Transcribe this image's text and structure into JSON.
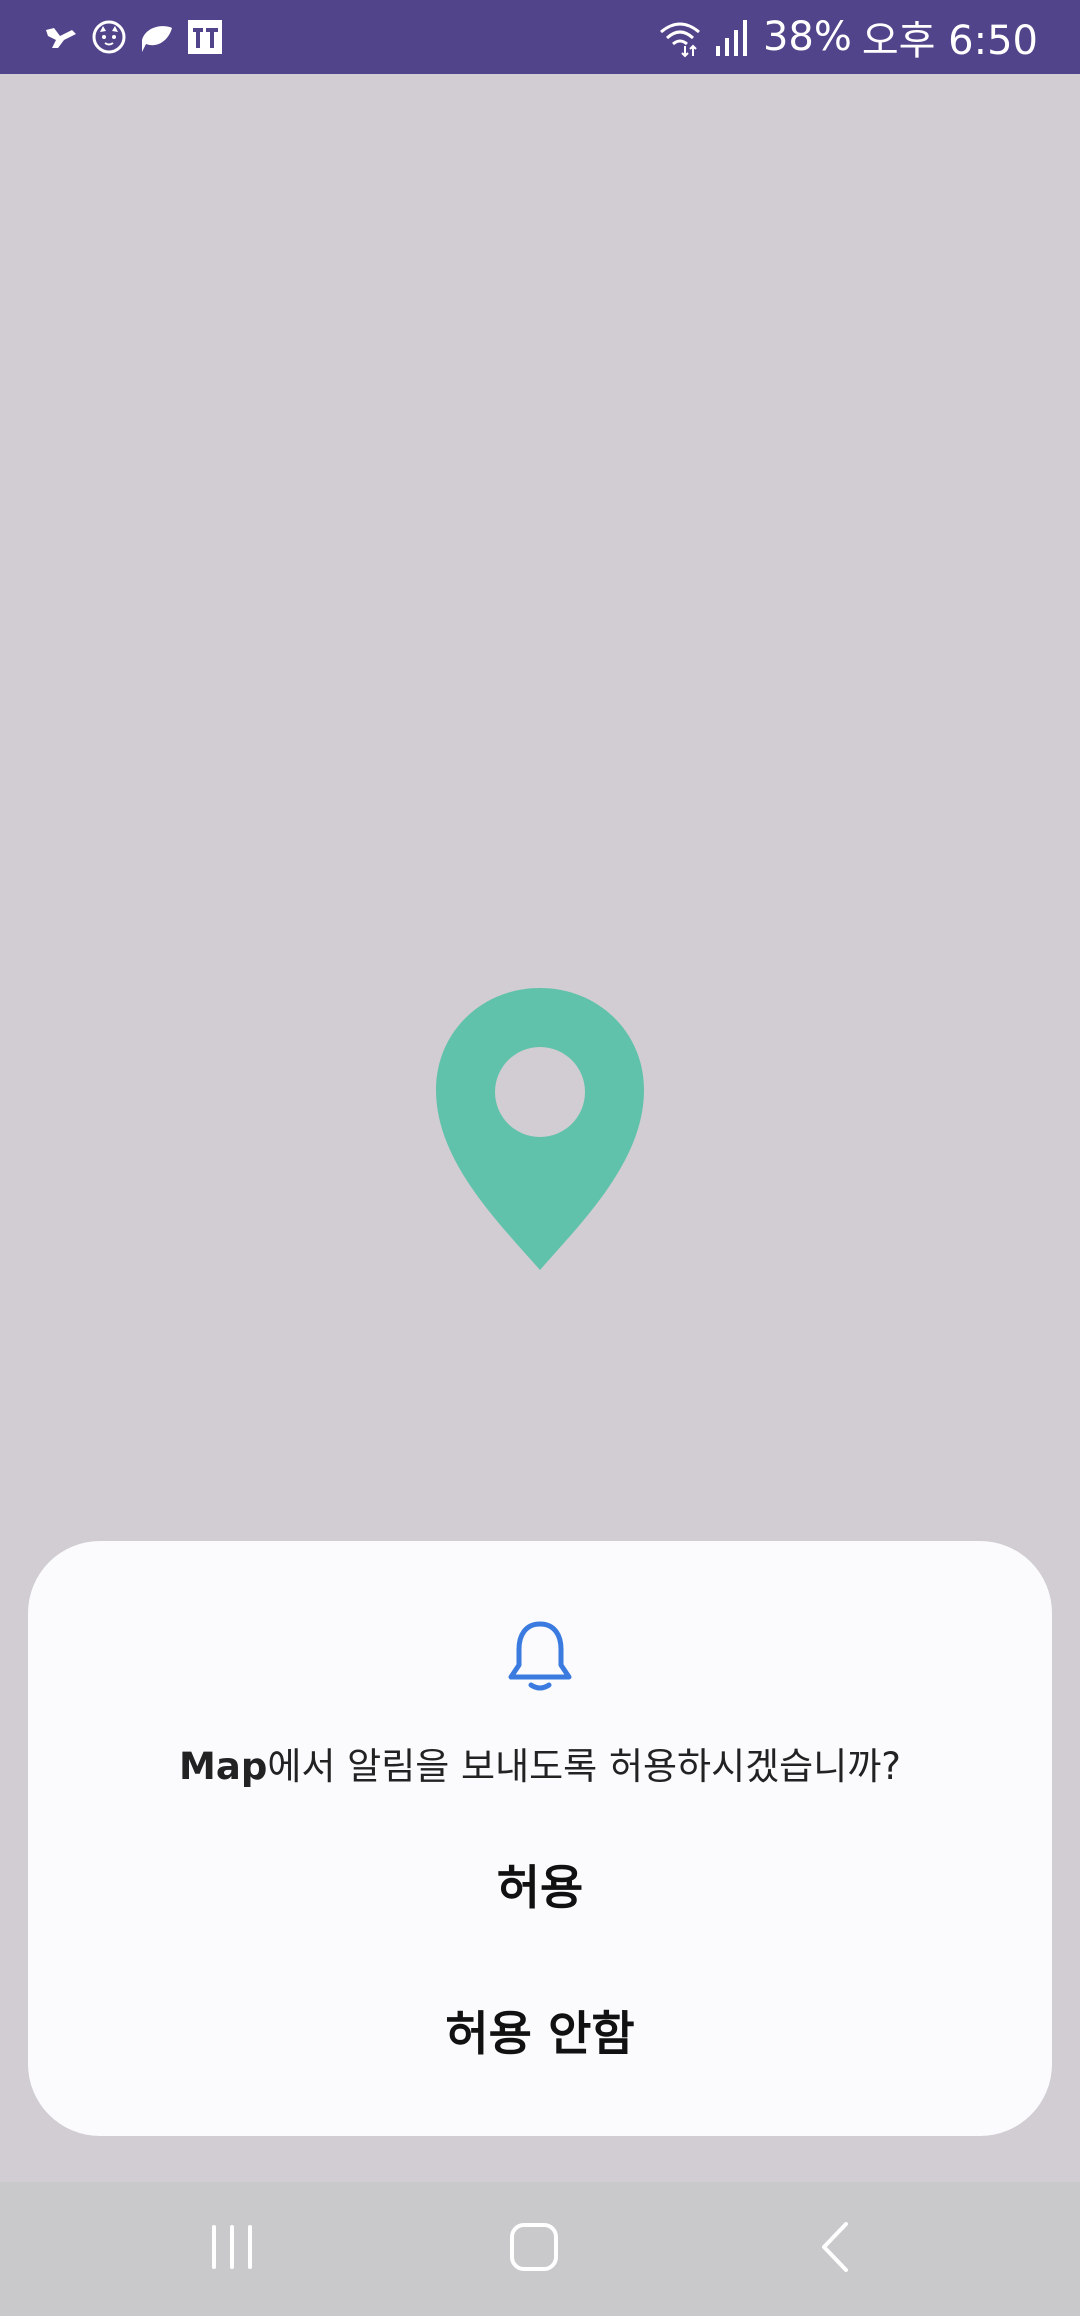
{
  "status_bar": {
    "notification_icons": [
      "bird-icon",
      "cat-face-icon",
      "leaf-icon",
      "tt-icon"
    ],
    "system_icons": [
      "wifi-6-icon",
      "signal-icon"
    ],
    "battery": "38%",
    "time": "오후 6:50",
    "background_color": "#52448a"
  },
  "splash": {
    "icon": "map-pin-icon",
    "pin_color": "#60c2ab"
  },
  "permission_dialog": {
    "icon": "bell-icon",
    "app_name": "Map",
    "message": "에서 알림을 보내도록 허용하시겠습니까?",
    "allow_label": "허용",
    "deny_label": "허용 안함",
    "accent_color": "#3b7be0"
  },
  "nav_bar": {
    "buttons": [
      "recents-icon",
      "home-icon",
      "back-icon"
    ]
  }
}
